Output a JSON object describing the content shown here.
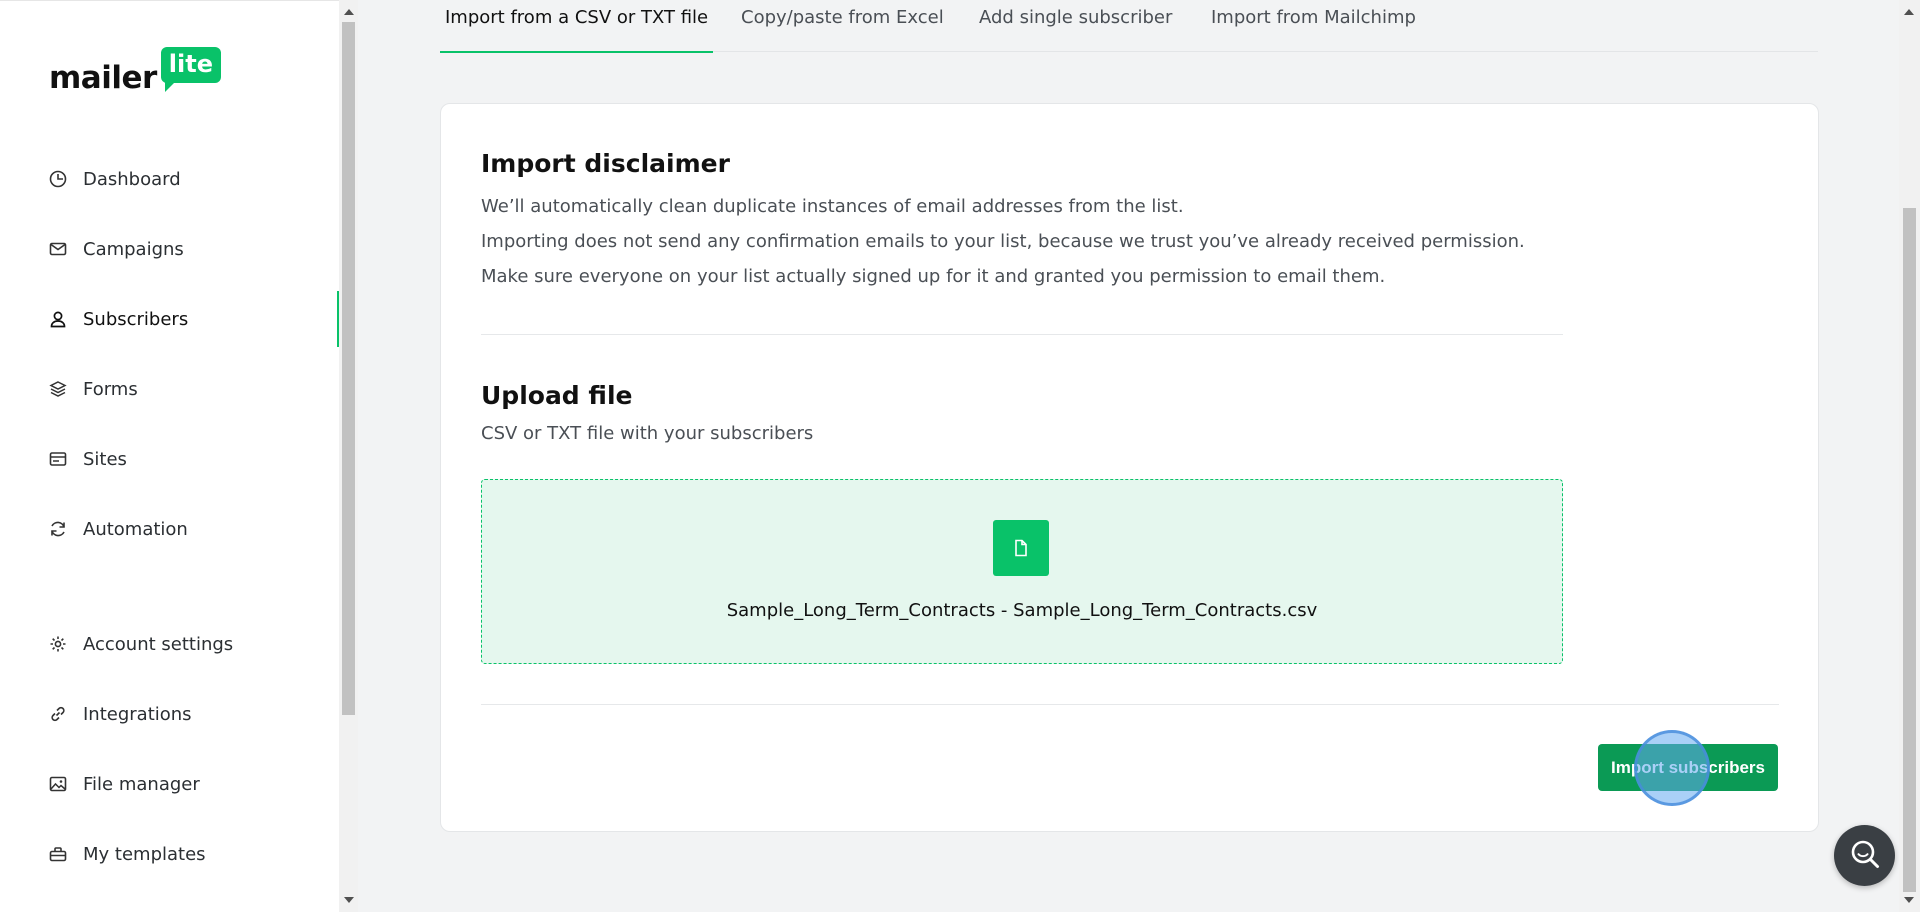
{
  "logo": {
    "word": "mailer",
    "badge": "lite"
  },
  "sidebar": {
    "items": [
      {
        "label": "Dashboard",
        "icon": "dashboard-icon"
      },
      {
        "label": "Campaigns",
        "icon": "mail-icon"
      },
      {
        "label": "Subscribers",
        "icon": "user-icon",
        "active": true
      },
      {
        "label": "Forms",
        "icon": "layers-icon"
      },
      {
        "label": "Sites",
        "icon": "browser-icon"
      },
      {
        "label": "Automation",
        "icon": "refresh-icon"
      },
      {
        "label": "Account settings",
        "icon": "gear-icon"
      },
      {
        "label": "Integrations",
        "icon": "link-icon"
      },
      {
        "label": "File manager",
        "icon": "image-icon"
      },
      {
        "label": "My templates",
        "icon": "briefcase-icon"
      }
    ]
  },
  "tabs": [
    {
      "label": "Import from a CSV or TXT file",
      "active": true
    },
    {
      "label": "Copy/paste from Excel"
    },
    {
      "label": "Add single subscriber"
    },
    {
      "label": "Import from Mailchimp"
    }
  ],
  "disclaimer": {
    "title": "Import disclaimer",
    "lines": [
      "We’ll automatically clean duplicate instances of email addresses from the list.",
      "Importing does not send any confirmation emails to your list, because we trust you’ve already received permission.",
      "Make sure everyone on your list actually signed up for it and granted you permission to email them."
    ]
  },
  "upload": {
    "title": "Upload file",
    "subtitle": "CSV or TXT file with your subscribers",
    "file_name": "Sample_Long_Term_Contracts - Sample_Long_Term_Contracts.csv",
    "file_icon": "file-icon"
  },
  "actions": {
    "import_label": "Import subscribers"
  },
  "help": {
    "icon": "search-chat-icon"
  },
  "colors": {
    "accent": "#09c269",
    "button": "#0b9a55",
    "dropzone_bg": "#e5f7ee"
  }
}
